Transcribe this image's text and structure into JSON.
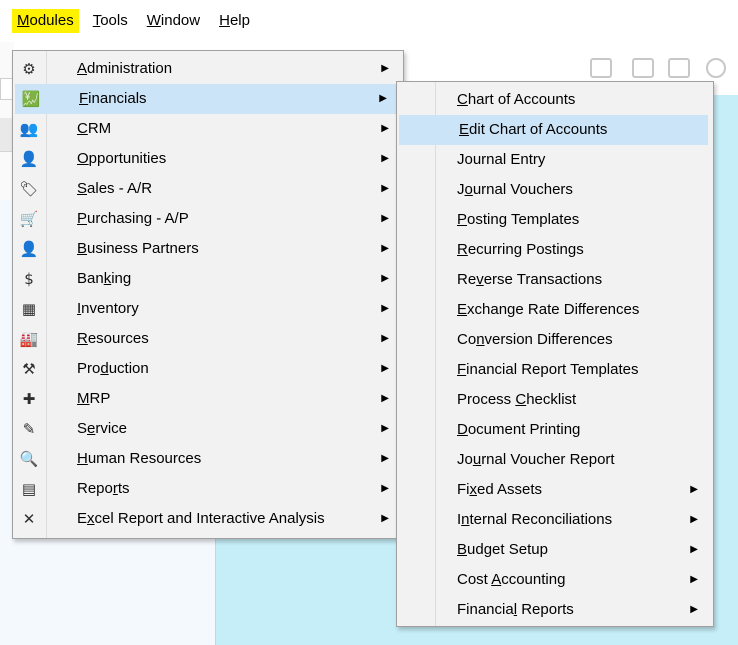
{
  "menubar": {
    "items": [
      {
        "pre": "",
        "key": "M",
        "post": "odules"
      },
      {
        "pre": "",
        "key": "T",
        "post": "ools"
      },
      {
        "pre": "",
        "key": "W",
        "post": "indow"
      },
      {
        "pre": "",
        "key": "H",
        "post": "elp"
      }
    ]
  },
  "modules_menu": {
    "items": [
      {
        "pre": "",
        "key": "A",
        "post": "dministration",
        "icon": "administration-icon",
        "glyph": "⚙"
      },
      {
        "pre": "",
        "key": "F",
        "post": "inancials",
        "icon": "financials-icon",
        "glyph": "💹"
      },
      {
        "pre": "",
        "key": "C",
        "post": "RM",
        "icon": "crm-icon",
        "glyph": "👥"
      },
      {
        "pre": "",
        "key": "O",
        "post": "pportunities",
        "icon": "opportunities-icon",
        "glyph": "👤"
      },
      {
        "pre": "",
        "key": "S",
        "post": "ales - A/R",
        "icon": "sales-icon",
        "glyph": "🏷"
      },
      {
        "pre": "",
        "key": "P",
        "post": "urchasing - A/P",
        "icon": "cart-icon",
        "glyph": "🛒"
      },
      {
        "pre": "",
        "key": "B",
        "post": "usiness Partners",
        "icon": "business-partner-icon",
        "glyph": "👤"
      },
      {
        "pre": "Ban",
        "key": "k",
        "post": "ing",
        "icon": "banking-icon",
        "glyph": "$"
      },
      {
        "pre": "",
        "key": "I",
        "post": "nventory",
        "icon": "inventory-icon",
        "glyph": "▦"
      },
      {
        "pre": "",
        "key": "R",
        "post": "esources",
        "icon": "resources-icon",
        "glyph": "🏭"
      },
      {
        "pre": "Pro",
        "key": "d",
        "post": "uction",
        "icon": "production-icon",
        "glyph": "⚒"
      },
      {
        "pre": "",
        "key": "M",
        "post": "RP",
        "icon": "mrp-icon",
        "glyph": "✚"
      },
      {
        "pre": "S",
        "key": "e",
        "post": "rvice",
        "icon": "service-icon",
        "glyph": "✎"
      },
      {
        "pre": "",
        "key": "H",
        "post": "uman Resources",
        "icon": "human-resources-icon",
        "glyph": "🔍"
      },
      {
        "pre": "Repo",
        "key": "r",
        "post": "ts",
        "icon": "reports-icon",
        "glyph": "▤"
      },
      {
        "pre": "E",
        "key": "x",
        "post": "cel Report and Interactive Analysis",
        "icon": "excel-report-icon",
        "glyph": "✕"
      }
    ]
  },
  "financials_menu": {
    "items": [
      {
        "pre": "",
        "key": "C",
        "post": "hart of Accounts",
        "submenu": false
      },
      {
        "pre": "",
        "key": "E",
        "post": "dit Chart of Accounts",
        "submenu": false
      },
      {
        "pre": "Journal Entry",
        "key": "",
        "post": "",
        "submenu": false
      },
      {
        "pre": "J",
        "key": "o",
        "post": "urnal Vouchers",
        "submenu": false
      },
      {
        "pre": "",
        "key": "P",
        "post": "osting Templates",
        "submenu": false
      },
      {
        "pre": "",
        "key": "R",
        "post": "ecurring Postings",
        "submenu": false
      },
      {
        "pre": "Re",
        "key": "v",
        "post": "erse Transactions",
        "submenu": false
      },
      {
        "pre": "",
        "key": "E",
        "post": "xchange Rate Differences",
        "submenu": false
      },
      {
        "pre": "Co",
        "key": "n",
        "post": "version Differences",
        "submenu": false
      },
      {
        "pre": "",
        "key": "F",
        "post": "inancial Report Templates",
        "submenu": false
      },
      {
        "pre": "Process ",
        "key": "C",
        "post": "hecklist",
        "submenu": false
      },
      {
        "pre": "",
        "key": "D",
        "post": "ocument Printing",
        "submenu": false
      },
      {
        "pre": "Jo",
        "key": "u",
        "post": "rnal Voucher Report",
        "submenu": false
      },
      {
        "pre": "Fi",
        "key": "x",
        "post": "ed Assets",
        "submenu": true
      },
      {
        "pre": "I",
        "key": "n",
        "post": "ternal Reconciliations",
        "submenu": true
      },
      {
        "pre": "",
        "key": "B",
        "post": "udget Setup",
        "submenu": true
      },
      {
        "pre": "Cost ",
        "key": "A",
        "post": "ccounting",
        "submenu": true
      },
      {
        "pre": "Financia",
        "key": "l",
        "post": " Reports",
        "submenu": true
      }
    ]
  },
  "colors": {
    "active_menubar": "#fff200",
    "menu_highlight": "#cce4f7",
    "menu_bg": "#f2f2f2",
    "workspace_teal": "#c6eef8"
  }
}
